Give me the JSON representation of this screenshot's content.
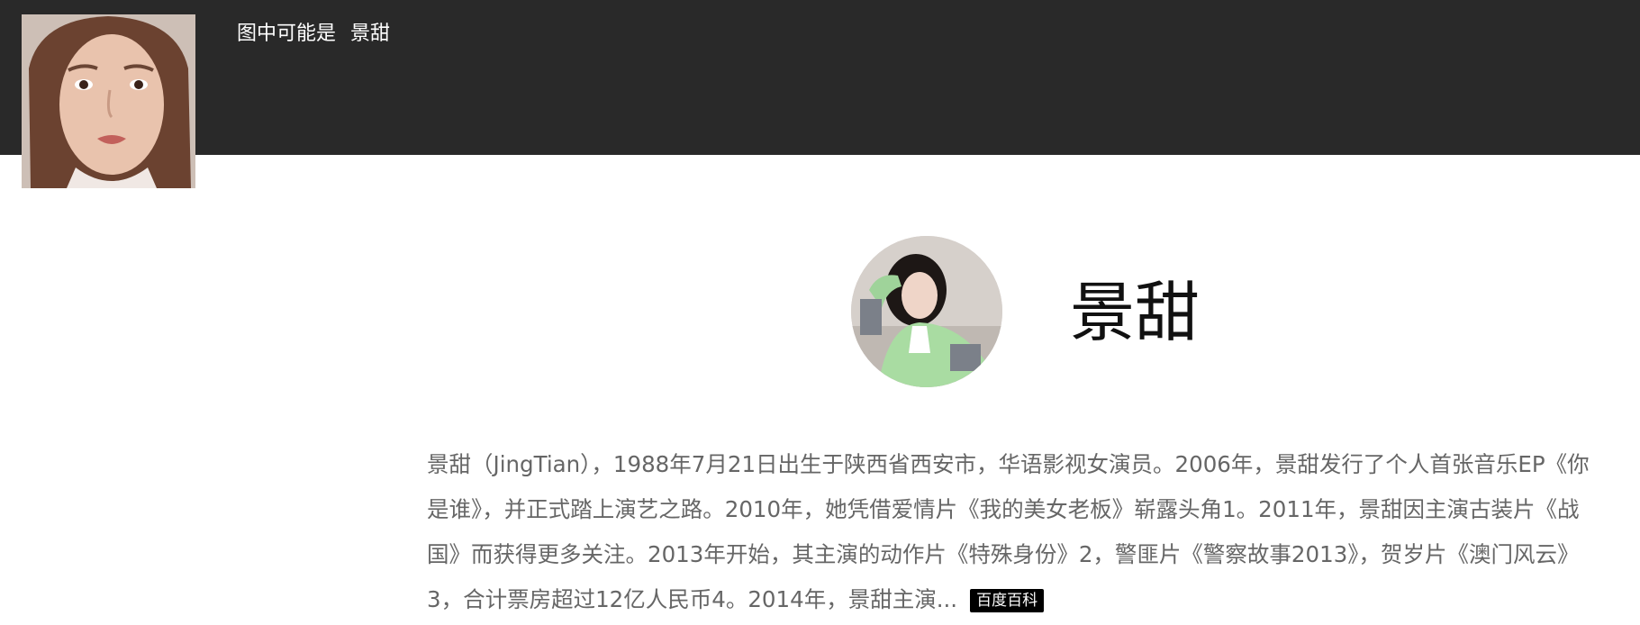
{
  "header": {
    "caption_prefix": "图中可能是",
    "caption_name": "景甜"
  },
  "entity": {
    "name": "景甜",
    "description": "景甜（JingTian），1988年7月21日出生于陕西省西安市，华语影视女演员。2006年，景甜发行了个人首张音乐EP《你是谁》，并正式踏上演艺之路。2010年，她凭借爱情片《我的美女老板》崭露头角1。2011年，景甜因主演古装片《战国》而获得更多关注。2013年开始，其主演的动作片《特殊身份》2，警匪片《警察故事2013》，贺岁片《澳门风云》3，合计票房超过12亿人民币4。2014年，景甜主演...",
    "source_badge": "百度百科"
  },
  "colors": {
    "header_bg": "#292929",
    "text_gray": "#666666",
    "badge_bg": "#000000"
  }
}
